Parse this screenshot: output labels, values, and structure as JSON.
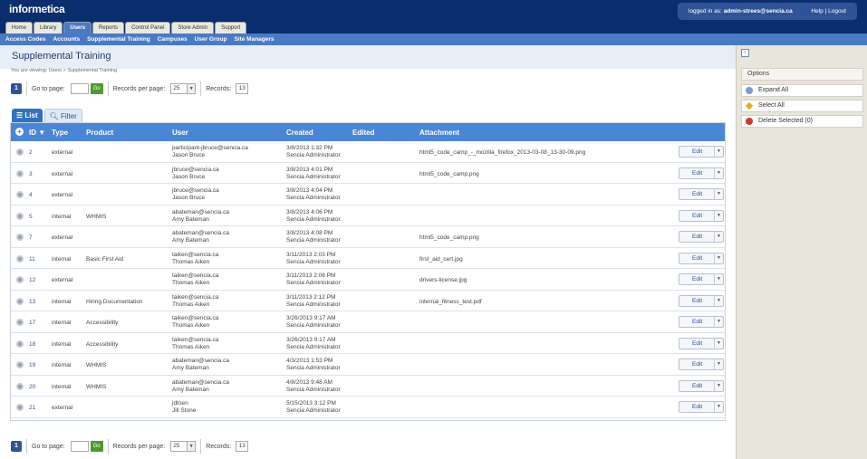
{
  "header": {
    "logo": "informetica",
    "logged_in_prefix": "logged in as:",
    "logged_in_user": "admin-strees@sencia.ca",
    "help": "Help",
    "logout": "Logout",
    "links_sep": "|"
  },
  "tabs": [
    "Home",
    "Library",
    "Users",
    "Reports",
    "Control Panel",
    "Store Admin",
    "Support"
  ],
  "subnav": [
    "Access Codes",
    "Accounts",
    "Supplemental Training",
    "Campuses",
    "User Group",
    "Site Managers"
  ],
  "page": {
    "title": "Supplemental Training",
    "breadcrumb": "You are viewing: Users > Supplemental Training"
  },
  "pager": {
    "current_page": "1",
    "goto_label": "Go to page:",
    "go_button": "Go",
    "rpp_label": "Records per page:",
    "rpp_value": "25",
    "records_label": "Records:",
    "records_value": "13"
  },
  "view_tabs": {
    "list": "List",
    "filter": "Filter"
  },
  "columns": {
    "id": "ID ▼",
    "type": "Type",
    "product": "Product",
    "user": "User",
    "created": "Created",
    "edited": "Edited",
    "attachment": "Attachment"
  },
  "edit_label": "Edit",
  "rows": [
    {
      "id": "2",
      "type": "external",
      "product": "",
      "email": "participant-jbruce@sencia.ca",
      "name": "Jason Bruce",
      "date": "3/8/2013 1:32 PM",
      "by": "Sencia Administrator",
      "attachment": "html5_code_camp_-_mozilla_firefox_2013-03-08_13-30-09.png"
    },
    {
      "id": "3",
      "type": "external",
      "product": "",
      "email": "jbruce@sencia.ca",
      "name": "Jason Bruce",
      "date": "3/8/2013 4:01 PM",
      "by": "Sencia Administrator",
      "attachment": "html5_code_camp.png"
    },
    {
      "id": "4",
      "type": "external",
      "product": "",
      "email": "jbruce@sencia.ca",
      "name": "Jason Bruce",
      "date": "3/8/2013 4:04 PM",
      "by": "Sencia Administrator",
      "attachment": ""
    },
    {
      "id": "5",
      "type": "internal",
      "product": "WHMIS",
      "email": "abateman@sencia.ca",
      "name": "Amy Bateman",
      "date": "3/8/2013 4:06 PM",
      "by": "Sencia Administrator",
      "attachment": ""
    },
    {
      "id": "7",
      "type": "external",
      "product": "",
      "email": "abateman@sencia.ca",
      "name": "Amy Bateman",
      "date": "3/8/2013 4:08 PM",
      "by": "Sencia Administrator",
      "attachment": "html5_code_camp.png"
    },
    {
      "id": "11",
      "type": "internal",
      "product": "Basic First Aid",
      "email": "taiken@sencia.ca",
      "name": "Thomas Aiken",
      "date": "3/11/2013 2:03 PM",
      "by": "Sencia Administrator",
      "attachment": "first_aid_cert.jpg"
    },
    {
      "id": "12",
      "type": "external",
      "product": "",
      "email": "taiken@sencia.ca",
      "name": "Thomas Aiken",
      "date": "3/11/2013 2:06 PM",
      "by": "Sencia Administrator",
      "attachment": "drivers-license.jpg"
    },
    {
      "id": "13",
      "type": "internal",
      "product": "Hiring Documentation",
      "email": "taiken@sencia.ca",
      "name": "Thomas Aiken",
      "date": "3/11/2013 2:12 PM",
      "by": "Sencia Administrator",
      "attachment": "internal_fitness_test.pdf"
    },
    {
      "id": "17",
      "type": "internal",
      "product": "Accessibility",
      "email": "taiken@sencia.ca",
      "name": "Thomas Aiken",
      "date": "3/26/2013 9:17 AM",
      "by": "Sencia Administrator",
      "attachment": ""
    },
    {
      "id": "18",
      "type": "internal",
      "product": "Accessibility",
      "email": "taiken@sencia.ca",
      "name": "Thomas Aiken",
      "date": "3/26/2013 9:17 AM",
      "by": "Sencia Administrator",
      "attachment": ""
    },
    {
      "id": "19",
      "type": "internal",
      "product": "WHMIS",
      "email": "abateman@sencia.ca",
      "name": "Amy Bateman",
      "date": "4/3/2013 1:53 PM",
      "by": "Sencia Administrator",
      "attachment": ""
    },
    {
      "id": "20",
      "type": "internal",
      "product": "WHMIS",
      "email": "abateman@sencia.ca",
      "name": "Amy Bateman",
      "date": "4/8/2013 9:48 AM",
      "by": "Sencia Administrator",
      "attachment": ""
    },
    {
      "id": "21",
      "type": "external",
      "product": "",
      "email": "jdtoen",
      "name": "Jill Stone",
      "date": "5/15/2013 3:12 PM",
      "by": "Sencia Administrator",
      "attachment": ""
    }
  ],
  "options": {
    "heading": "Options",
    "expand_all": "Expand All",
    "select_all": "Select All",
    "delete_selected": "Delete Selected (0)"
  },
  "colors": {
    "header": "#0a2d6e",
    "nav": "#4a7ac4",
    "grid_head": "#4a86d6",
    "go": "#4c9a2a"
  }
}
